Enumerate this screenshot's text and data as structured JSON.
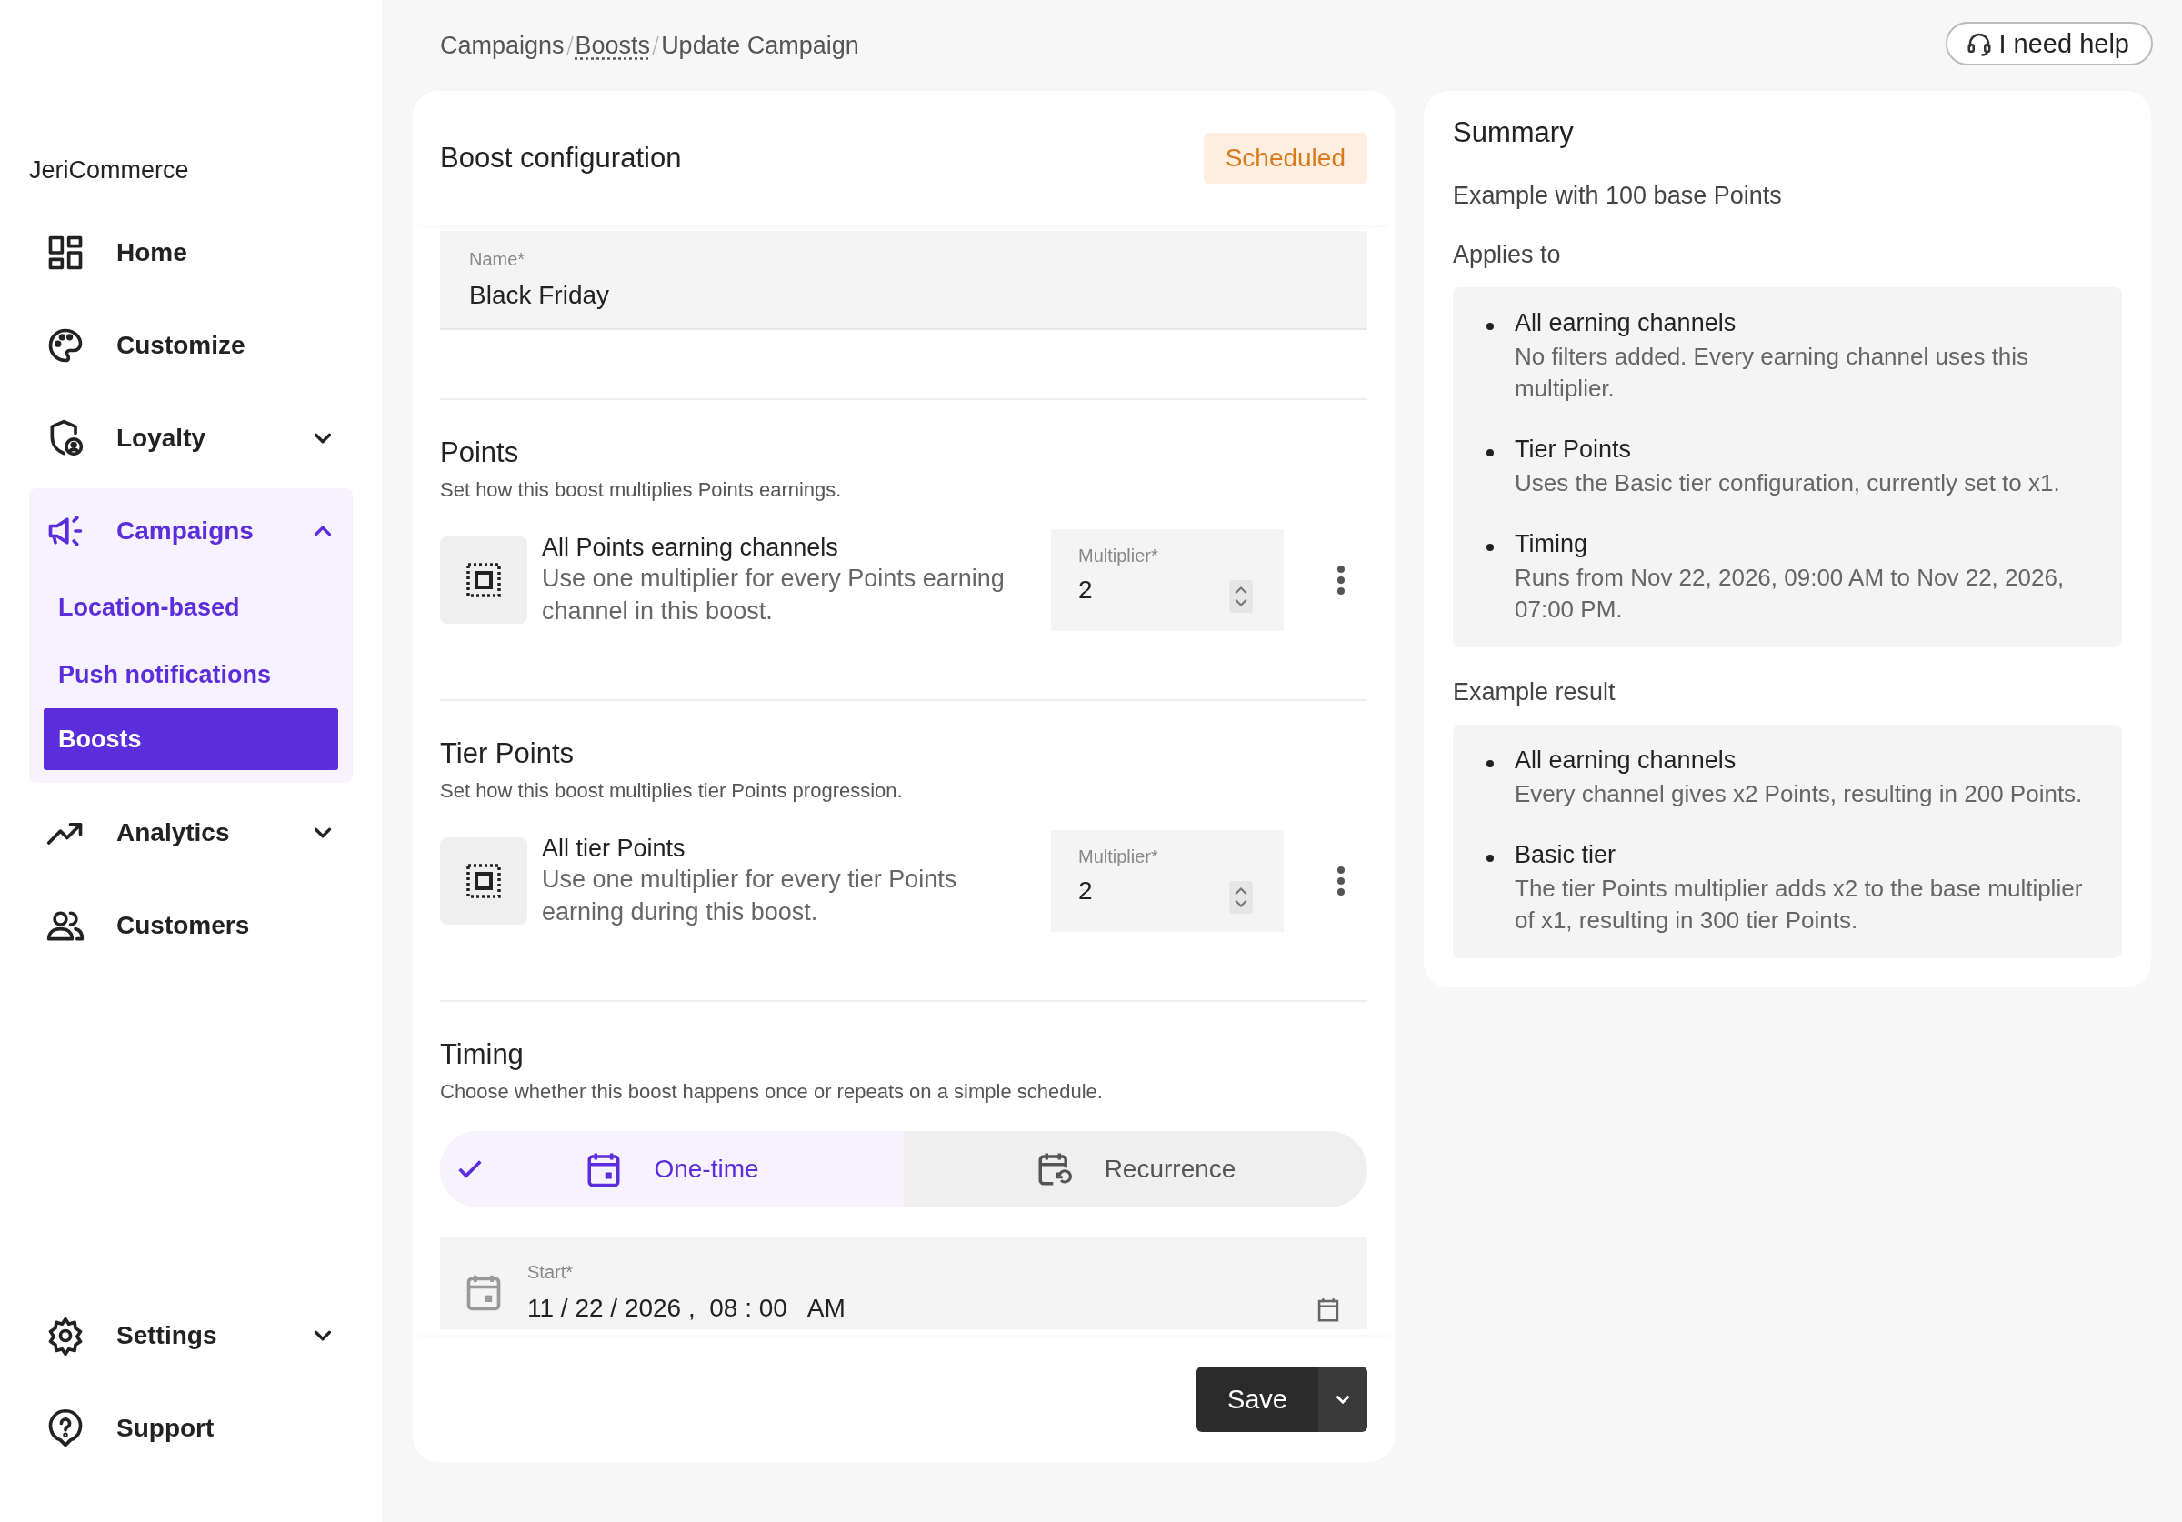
{
  "sidebar": {
    "brand": "JeriCommerce",
    "items": [
      {
        "label": "Home",
        "selected": false
      },
      {
        "label": "Customize",
        "selected": false
      },
      {
        "label": "Loyalty",
        "selected": false,
        "expanded": false
      },
      {
        "label": "Campaigns",
        "selected": true,
        "expanded": true,
        "children": [
          {
            "label": "Location-based",
            "selected": false
          },
          {
            "label": "Push notifications",
            "selected": false
          },
          {
            "label": "Boosts",
            "selected": true
          }
        ]
      },
      {
        "label": "Analytics",
        "selected": false,
        "expanded": false
      },
      {
        "label": "Customers",
        "selected": false
      }
    ],
    "bottom_items": [
      {
        "label": "Settings",
        "selected": false,
        "expanded": false
      },
      {
        "label": "Support",
        "selected": false
      }
    ]
  },
  "breadcrumb": [
    {
      "label": "Campaigns",
      "kind": "text"
    },
    {
      "label": "Boosts",
      "kind": "link"
    },
    {
      "label": "Update Campaign",
      "kind": "current"
    }
  ],
  "help_button": "I need help",
  "config": {
    "title": "Boost configuration",
    "status": "Scheduled",
    "name_field": {
      "label": "Name*",
      "value": "Black Friday"
    },
    "sections": [
      {
        "title": "Points",
        "description": "Set how this boost multiplies Points earnings.",
        "rule": {
          "title": "All Points earning channels",
          "description": "Use one multiplier for every Points earning channel in this boost.",
          "multiplier_label": "Multiplier*",
          "multiplier": "2"
        }
      },
      {
        "title": "Tier Points",
        "description": "Set how this boost multiplies tier Points progression.",
        "rule": {
          "title": "All tier Points",
          "description": "Use one multiplier for every tier Points earning during this boost.",
          "multiplier_label": "Multiplier*",
          "multiplier": "2"
        }
      }
    ],
    "timing": {
      "title": "Timing",
      "description": "Choose whether this boost happens once or repeats on a simple schedule.",
      "options": [
        {
          "label": "One-time",
          "selected": true
        },
        {
          "label": "Recurrence",
          "selected": false
        }
      ],
      "start_field": {
        "label": "Start*",
        "value": "11 / 22 / 2026 ,  08 : 00   AM"
      }
    },
    "save_button": "Save"
  },
  "summary": {
    "title": "Summary",
    "subtitle": "Example with 100 base Points",
    "groups": [
      {
        "heading": "Applies to",
        "items": [
          {
            "title": "All earning channels",
            "text": "No filters added. Every earning channel uses this multiplier."
          },
          {
            "title": "Tier Points",
            "text": "Uses the Basic tier configuration, currently set to x1."
          },
          {
            "title": "Timing",
            "text": "Runs from Nov 22, 2026, 09:00 AM to Nov 22, 2026, 07:00 PM."
          }
        ]
      },
      {
        "heading": "Example result",
        "items": [
          {
            "title": "All earning channels",
            "text": "Every channel gives x2 Points, resulting in 200 Points."
          },
          {
            "title": "Basic tier",
            "text": "The tier Points multiplier adds x2 to the base multiplier of x1, resulting in 300 tier Points."
          }
        ]
      }
    ]
  }
}
